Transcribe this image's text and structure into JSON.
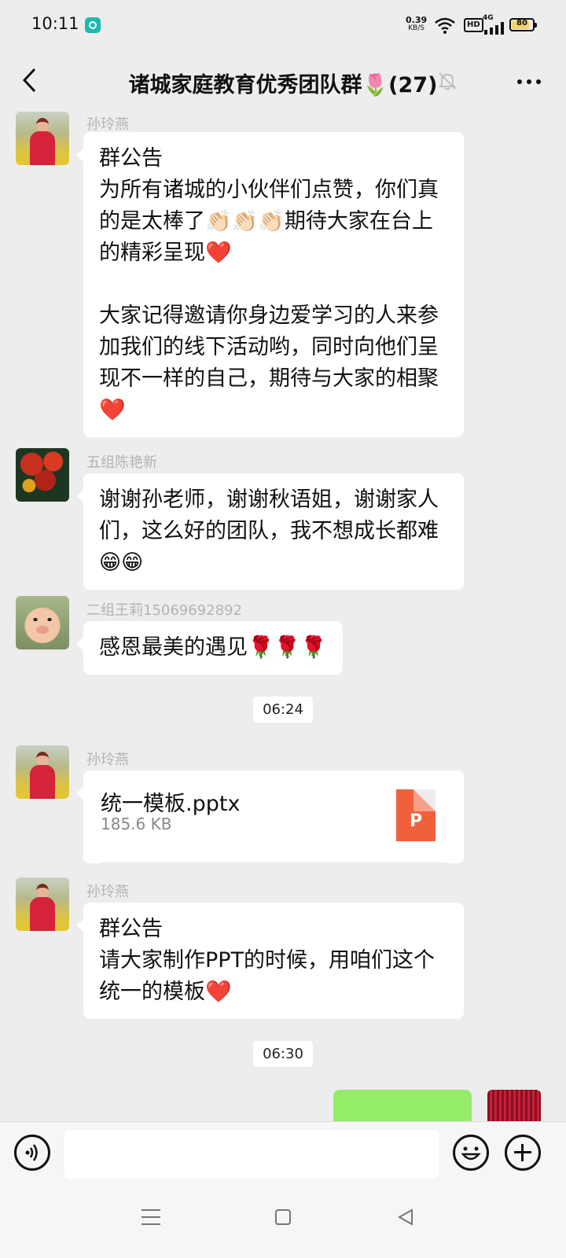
{
  "status_bar": {
    "time": "10:11",
    "net_speed_value": "0.39",
    "net_speed_unit": "KB/S",
    "hd_label": "HD",
    "network_label": "4G",
    "battery_level": "80"
  },
  "header": {
    "title": "诸城家庭教育优秀团队群🌷(27)"
  },
  "messages": [
    {
      "sender": "孙玲燕",
      "text_lines": [
        "群公告",
        "为所有诸城的小伙伴们点赞，你们真",
        "的是太棒了👏🏻👏🏻👏🏻期待大家在台上",
        "的精彩呈现❤️",
        "",
        "大家记得邀请你身边爱学习的人来参",
        "加我们的线下活动哟，同时向他们呈",
        "现不一样的自己，期待与大家的相聚",
        "❤️"
      ]
    },
    {
      "sender": "五组陈艳新",
      "text_lines": [
        "谢谢孙老师，谢谢秋语姐，谢谢家人",
        "们，这么好的团队，我不想成长都难",
        "😁😁"
      ]
    },
    {
      "sender": "二组王莉15069692892",
      "text_lines": [
        "感恩最美的遇见🌹🌹🌹"
      ]
    },
    {
      "timestamp": "06:24"
    },
    {
      "sender": "孙玲燕",
      "file": {
        "name": "统一模板.pptx",
        "size": "185.6 KB",
        "icon_letter": "P"
      }
    },
    {
      "sender": "孙玲燕",
      "text_lines": [
        "群公告",
        "请大家制作PPT的时候，用咱们这个",
        "统一的模板❤️"
      ]
    },
    {
      "timestamp": "06:30"
    }
  ],
  "input": {
    "value": "",
    "placeholder": ""
  },
  "colors": {
    "background": "#ededed",
    "bubble_other": "#ffffff",
    "bubble_self": "#95ec69",
    "file_icon": "#f0603a"
  },
  "icons": {
    "back": "chevron-left-icon",
    "mute": "bell-off-icon",
    "more": "more-dots-icon",
    "voice": "voice-icon",
    "emoji": "emoji-icon",
    "plus": "plus-icon",
    "file": "ppt-file-icon"
  }
}
